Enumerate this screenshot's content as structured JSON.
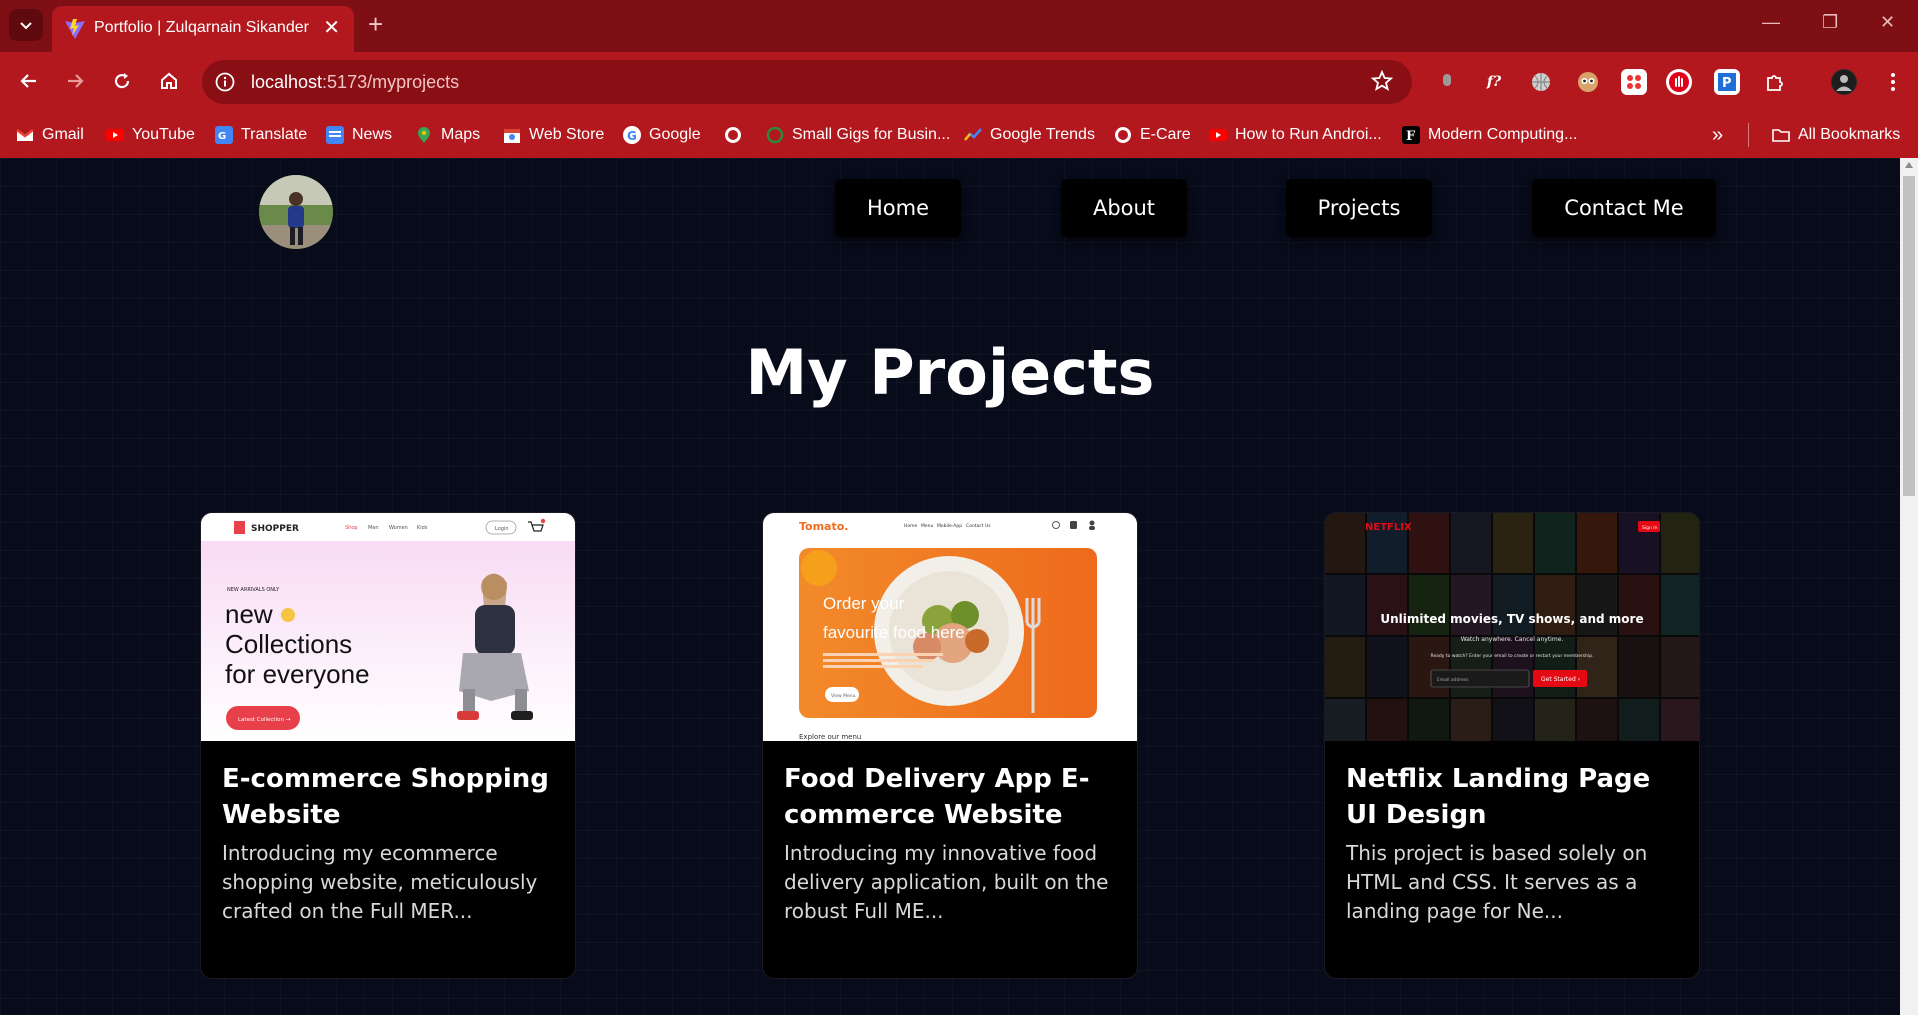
{
  "browser": {
    "tab_title": "Portfolio | Zulqarnain Sikander",
    "tab_close": "✕",
    "new_tab": "+",
    "url_host": "localhost",
    "url_path": ":5173/myprojects",
    "bookmarks": [
      "Gmail",
      "YouTube",
      "Translate",
      "News",
      "Maps",
      "Web Store",
      "Google",
      "Small Gigs for Busin...",
      "Google Trends",
      "E-Care",
      "How to Run Androi...",
      "Modern Computing..."
    ],
    "more_bookmarks": "»",
    "all_bookmarks": "All Bookmarks"
  },
  "nav": {
    "home": "Home",
    "about": "About",
    "projects": "Projects",
    "contact": "Contact Me"
  },
  "page_title": "My Projects",
  "projects": [
    {
      "title": "E-commerce Shopping Website",
      "description": "Introducing my ecommerce shopping website, meticulously crafted on the Full MER...",
      "thumb": {
        "brand": "SHOPPER",
        "menu": [
          "Shop",
          "Men",
          "Women",
          "Kids"
        ],
        "login": "Login",
        "tag": "NEW ARRIVALS ONLY",
        "line1": "new",
        "line2": "Collections",
        "line3": "for everyone",
        "button": "Latest Collection →"
      }
    },
    {
      "title": "Food Delivery App E-commerce Website",
      "description": "Introducing my innovative food delivery application, built on the robust Full ME...",
      "thumb": {
        "brand": "Tomato.",
        "menu": [
          "Home",
          "Menu",
          "Mobile-App",
          "Contact Us"
        ],
        "line1": "Order your",
        "line2": "favourite food here",
        "button": "View Menu",
        "footer": "Explore our menu"
      }
    },
    {
      "title": "Netflix Landing Page UI Design",
      "description": "This project is based solely on HTML and CSS. It serves as a landing page for Ne...",
      "thumb": {
        "brand": "NETFLIX",
        "signin": "Sign In",
        "headline": "Unlimited movies, TV shows, and more",
        "sub": "Watch anywhere. Cancel anytime.",
        "prompt": "Ready to watch? Enter your email to create or restart your membership.",
        "email_placeholder": "Email address",
        "button": "Get Started ›"
      }
    }
  ],
  "colors": {
    "chrome_tabbar": "#7e1015",
    "chrome_toolbar": "#b3181f",
    "page_bg": "#070b1a",
    "card_bg": "#000000",
    "shopper_red": "#e8404a",
    "tomato_orange": "#f26b1d",
    "netflix_red": "#e50914"
  }
}
